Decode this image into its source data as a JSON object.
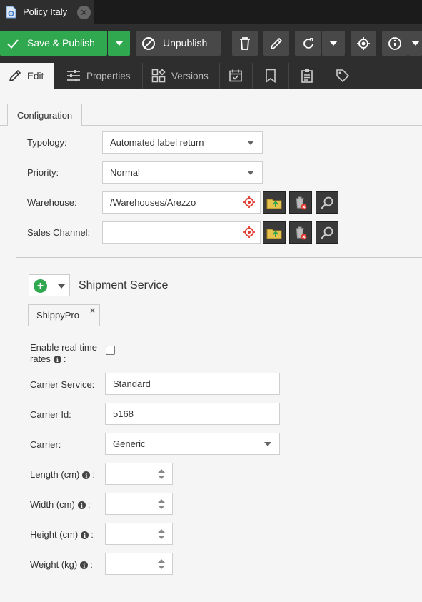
{
  "window": {
    "tab_title": "Policy Italy"
  },
  "toolbar": {
    "save_publish": "Save & Publish",
    "unpublish": "Unpublish"
  },
  "subtabs": {
    "edit": "Edit",
    "properties": "Properties",
    "versions": "Versions"
  },
  "config": {
    "tab_label": "Configuration",
    "typology": {
      "label": "Typology:",
      "value": "Automated label return"
    },
    "priority": {
      "label": "Priority:",
      "value": "Normal"
    },
    "warehouse": {
      "label": "Warehouse:",
      "value": "/Warehouses/Arezzo"
    },
    "sales_channel": {
      "label": "Sales Channel:",
      "value": ""
    }
  },
  "shipment": {
    "title": "Shipment Service",
    "tab_label": "ShippyPro",
    "close_glyph": "×",
    "enable_rates_line1": "Enable real time",
    "enable_rates_line2": "rates",
    "carrier_service": {
      "label": "Carrier Service:",
      "value": "Standard"
    },
    "carrier_id": {
      "label": "Carrier Id:",
      "value": "5168"
    },
    "carrier": {
      "label": "Carrier:",
      "value": "Generic"
    },
    "length": {
      "label": "Length (cm)",
      "value": ""
    },
    "width": {
      "label": "Width (cm)",
      "value": ""
    },
    "height": {
      "label": "Height (cm)",
      "value": ""
    },
    "weight": {
      "label": "Weight (kg)",
      "value": ""
    }
  },
  "colors": {
    "accent_green": "#2fa84f",
    "toolbar_bg": "#2e2e2e",
    "target_red": "#e03c31"
  }
}
